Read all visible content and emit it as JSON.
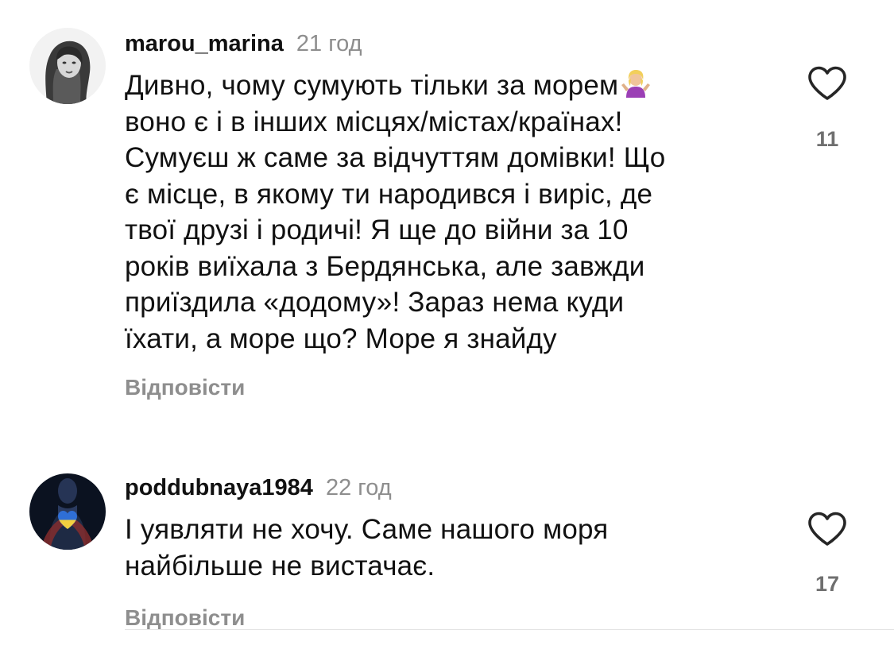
{
  "comments": [
    {
      "username": "marou_marina",
      "time": "21 год",
      "lines": [
        "Дивно, чому сумують тільки за морем",
        "воно є і в інших місцях/містах/країнах!",
        "Сумуєш ж саме за відчуттям домівки! Що",
        "є місце, в якому ти народився і виріс, де",
        "твої друзі і родичі! Я ще до війни за 10",
        "років виїхала з Бердянська, але завжди",
        "приїздила «додому»! Зараз нема куди",
        "їхати, а море що? Море я знайду"
      ],
      "emoji": "person-shrugging-emoji",
      "reply_label": "Відповісти",
      "likes": "11",
      "avatar_icon": "woman-portrait-avatar"
    },
    {
      "username": "poddubnaya1984",
      "time": "22 год",
      "lines": [
        "І уявляти не хочу. Саме нашого моря",
        "найбільше не вистачає."
      ],
      "reply_label": "Відповісти",
      "likes": "17",
      "avatar_icon": "heart-flag-avatar"
    }
  ],
  "colors": {
    "text": "#111111",
    "secondary": "#8e8e8e",
    "like_count": "#6f6f6f",
    "heart_stroke": "#262626",
    "flag_blue": "#2f6fd6",
    "flag_yellow": "#f4d03f"
  }
}
